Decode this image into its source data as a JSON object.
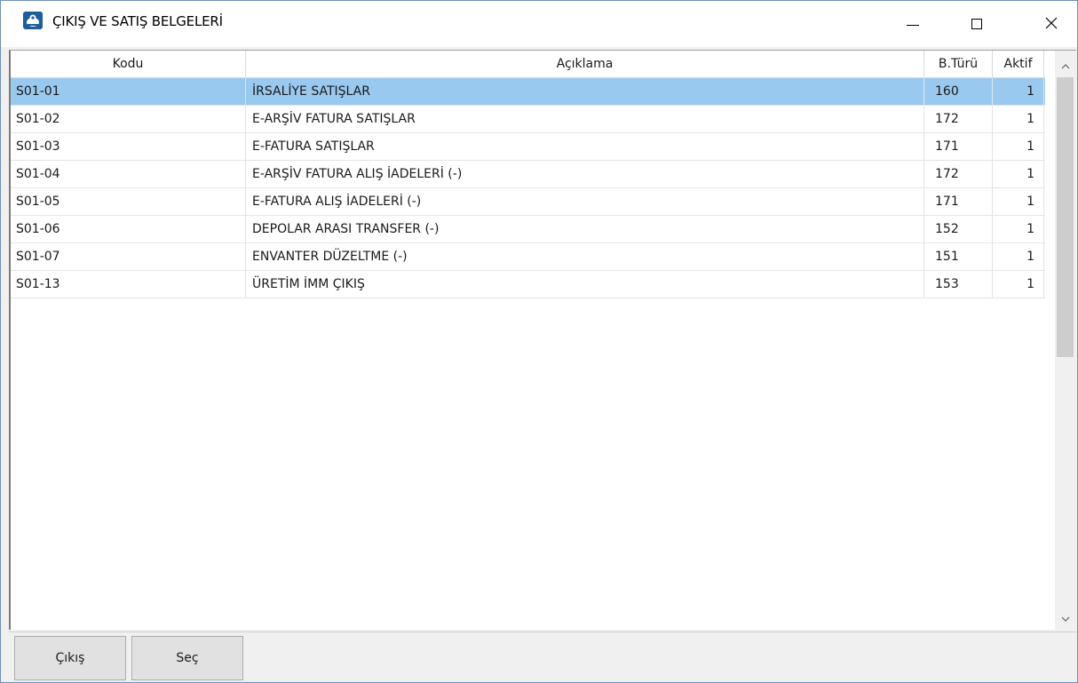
{
  "window": {
    "title": "ÇIKIŞ VE SATIŞ BELGELERİ",
    "app_icon": "app-logo-icon",
    "controls": [
      "minimize-icon",
      "maximize-icon",
      "close-icon"
    ]
  },
  "grid": {
    "columns": [
      "Kodu",
      "Açıklama",
      "B.Türü",
      "Aktif"
    ],
    "rows": [
      {
        "kodu": "S01-01",
        "aciklama": "İRSALİYE SATIŞLAR",
        "turu": "160",
        "aktif": "1"
      },
      {
        "kodu": "S01-02",
        "aciklama": "E-ARŞİV FATURA SATIŞLAR",
        "turu": "172",
        "aktif": "1"
      },
      {
        "kodu": "S01-03",
        "aciklama": "E-FATURA SATIŞLAR",
        "turu": "171",
        "aktif": "1"
      },
      {
        "kodu": "S01-04",
        "aciklama": "E-ARŞİV FATURA ALIŞ İADELERİ (-)",
        "turu": "172",
        "aktif": "1"
      },
      {
        "kodu": "S01-05",
        "aciklama": "E-FATURA ALIŞ İADELERİ (-)",
        "turu": "171",
        "aktif": "1"
      },
      {
        "kodu": "S01-06",
        "aciklama": "DEPOLAR ARASI TRANSFER (-)",
        "turu": "152",
        "aktif": "1"
      },
      {
        "kodu": "S01-07",
        "aciklama": "ENVANTER DÜZELTME (-)",
        "turu": "151",
        "aktif": "1"
      },
      {
        "kodu": "S01-13",
        "aciklama": "ÜRETİM İMM ÇIKIŞ",
        "turu": "153",
        "aktif": "1"
      }
    ],
    "selected_row": 0
  },
  "buttons": {
    "exit": "Çıkış",
    "select": "Seç"
  },
  "colors": {
    "selection": "#99c9ef",
    "window_border": "#6d8fbd",
    "button_face": "#e1e1e1"
  }
}
